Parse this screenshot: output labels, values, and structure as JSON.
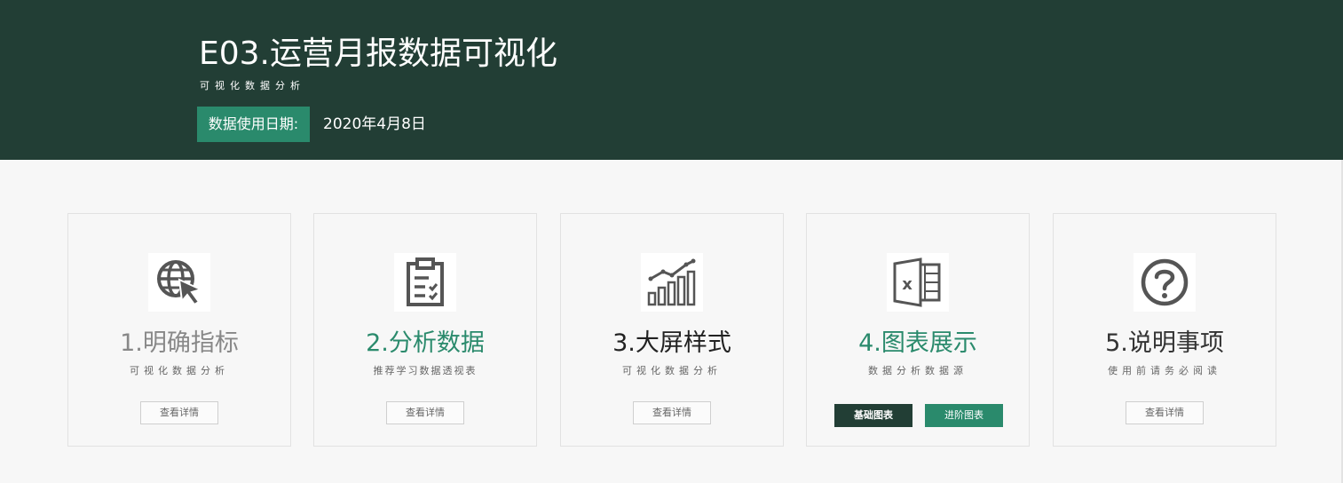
{
  "header": {
    "title": "E03.运营月报数据可视化",
    "subtitle": "可视化数据分析",
    "date_label": "数据使用日期:",
    "date_value": "2020年4月8日"
  },
  "colors": {
    "header_bg": "#223e35",
    "accent_green": "#2a8a6c",
    "title_gray": "#888888",
    "title_green": "#2a8a6c",
    "title_dark": "#222222"
  },
  "cards": [
    {
      "title": "1.明确指标",
      "desc": "可视化数据分析",
      "button": "查看详情",
      "icon": "globe-cursor-icon",
      "title_color": "#888888"
    },
    {
      "title": "2.分析数据",
      "desc": "推荐学习数据透视表",
      "button": "查看详情",
      "icon": "clipboard-check-icon",
      "title_color": "#2a8a6c"
    },
    {
      "title": "3.大屏样式",
      "desc": "可视化数据分析",
      "button": "查看详情",
      "icon": "bar-chart-trend-icon",
      "title_color": "#222222"
    },
    {
      "title": "4.图表展示",
      "desc": "数据分析数据源",
      "buttons": [
        "基础图表",
        "进阶图表"
      ],
      "icon": "excel-icon",
      "title_color": "#2a8a6c"
    },
    {
      "title": "5.说明事项",
      "desc": "使用前请务必阅读",
      "button": "查看详情",
      "icon": "question-circle-icon",
      "title_color": "#333333"
    }
  ]
}
